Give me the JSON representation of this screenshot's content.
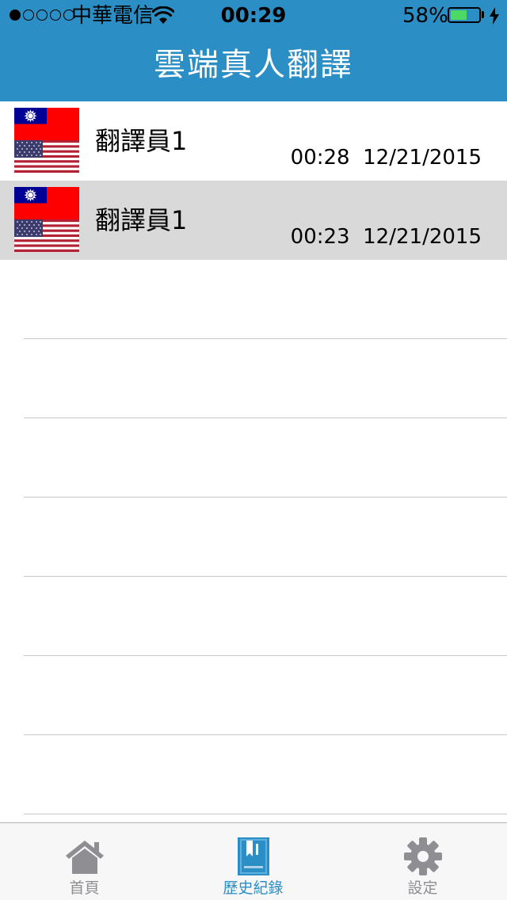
{
  "status_bar": {
    "signal_bars_filled": 1,
    "signal_bars_total": 5,
    "carrier": "中華電信",
    "time": "00:29",
    "battery": "58%",
    "battery_level": 0.58
  },
  "nav": {
    "title": "雲端真人翻譯"
  },
  "history": [
    {
      "name": "翻譯員1",
      "time": "00:28",
      "date": "12/21/2015",
      "selected": false,
      "from_flag": "taiwan-flag-icon",
      "to_flag": "usa-flag-icon"
    },
    {
      "name": "翻譯員1",
      "time": "00:23",
      "date": "12/21/2015",
      "selected": true,
      "from_flag": "taiwan-flag-icon",
      "to_flag": "usa-flag-icon"
    }
  ],
  "tabs": [
    {
      "label": "首頁",
      "icon": "home-icon",
      "active": false
    },
    {
      "label": "歷史紀錄",
      "icon": "history-book-icon",
      "active": true
    },
    {
      "label": "設定",
      "icon": "gear-icon",
      "active": false
    }
  ],
  "colors": {
    "brand": "#2b8ec4",
    "selected_row": "#d9d9d9",
    "battery": "#4cd964"
  }
}
